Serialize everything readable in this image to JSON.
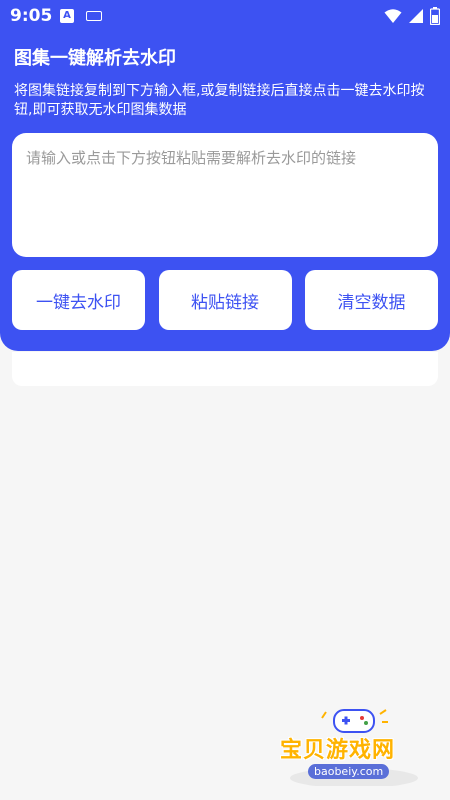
{
  "status_bar": {
    "time": "9:05",
    "notification_icon_a": "A"
  },
  "header": {
    "title": "图集一键解析去水印",
    "description": "将图集链接复制到下方输入框,或复制链接后直接点击一键去水印按钮,即可获取无水印图集数据"
  },
  "input": {
    "placeholder": "请输入或点击下方按钮粘贴需要解析去水印的链接",
    "value": ""
  },
  "buttons": {
    "remove_watermark": "一键去水印",
    "paste_link": "粘贴链接",
    "clear_data": "清空数据"
  },
  "watermark": {
    "name": "宝贝游戏网",
    "url": "baobeiy.com"
  },
  "colors": {
    "primary": "#3d52f2",
    "background": "#f6f6f6",
    "card": "#ffffff",
    "watermark": "#ffb300"
  }
}
